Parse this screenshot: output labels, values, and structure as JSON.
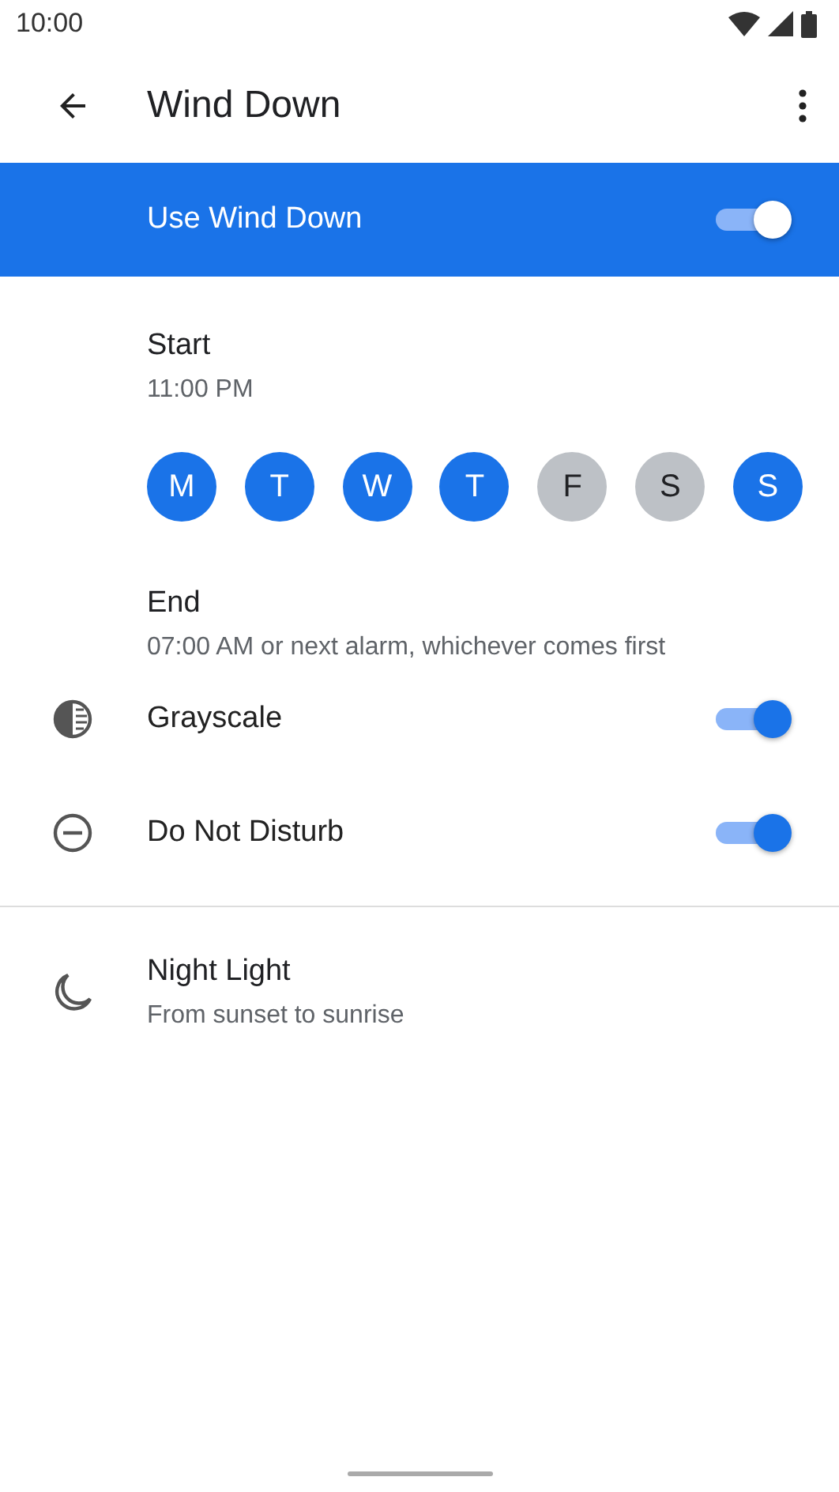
{
  "status_bar": {
    "time": "10:00"
  },
  "toolbar": {
    "title": "Wind Down"
  },
  "master_switch": {
    "label": "Use Wind Down",
    "on": true
  },
  "start": {
    "title": "Start",
    "value": "11:00 PM"
  },
  "days": [
    {
      "label": "M",
      "selected": true
    },
    {
      "label": "T",
      "selected": true
    },
    {
      "label": "W",
      "selected": true
    },
    {
      "label": "T",
      "selected": true
    },
    {
      "label": "F",
      "selected": false
    },
    {
      "label": "S",
      "selected": false
    },
    {
      "label": "S",
      "selected": true
    }
  ],
  "end": {
    "title": "End",
    "value": "07:00 AM or next alarm, whichever comes first"
  },
  "toggles": [
    {
      "kind": "grayscale",
      "label": "Grayscale",
      "on": true
    },
    {
      "kind": "dnd",
      "label": "Do Not Disturb",
      "on": true
    }
  ],
  "night_light": {
    "title": "Night Light",
    "value": "From sunset to sunrise"
  }
}
